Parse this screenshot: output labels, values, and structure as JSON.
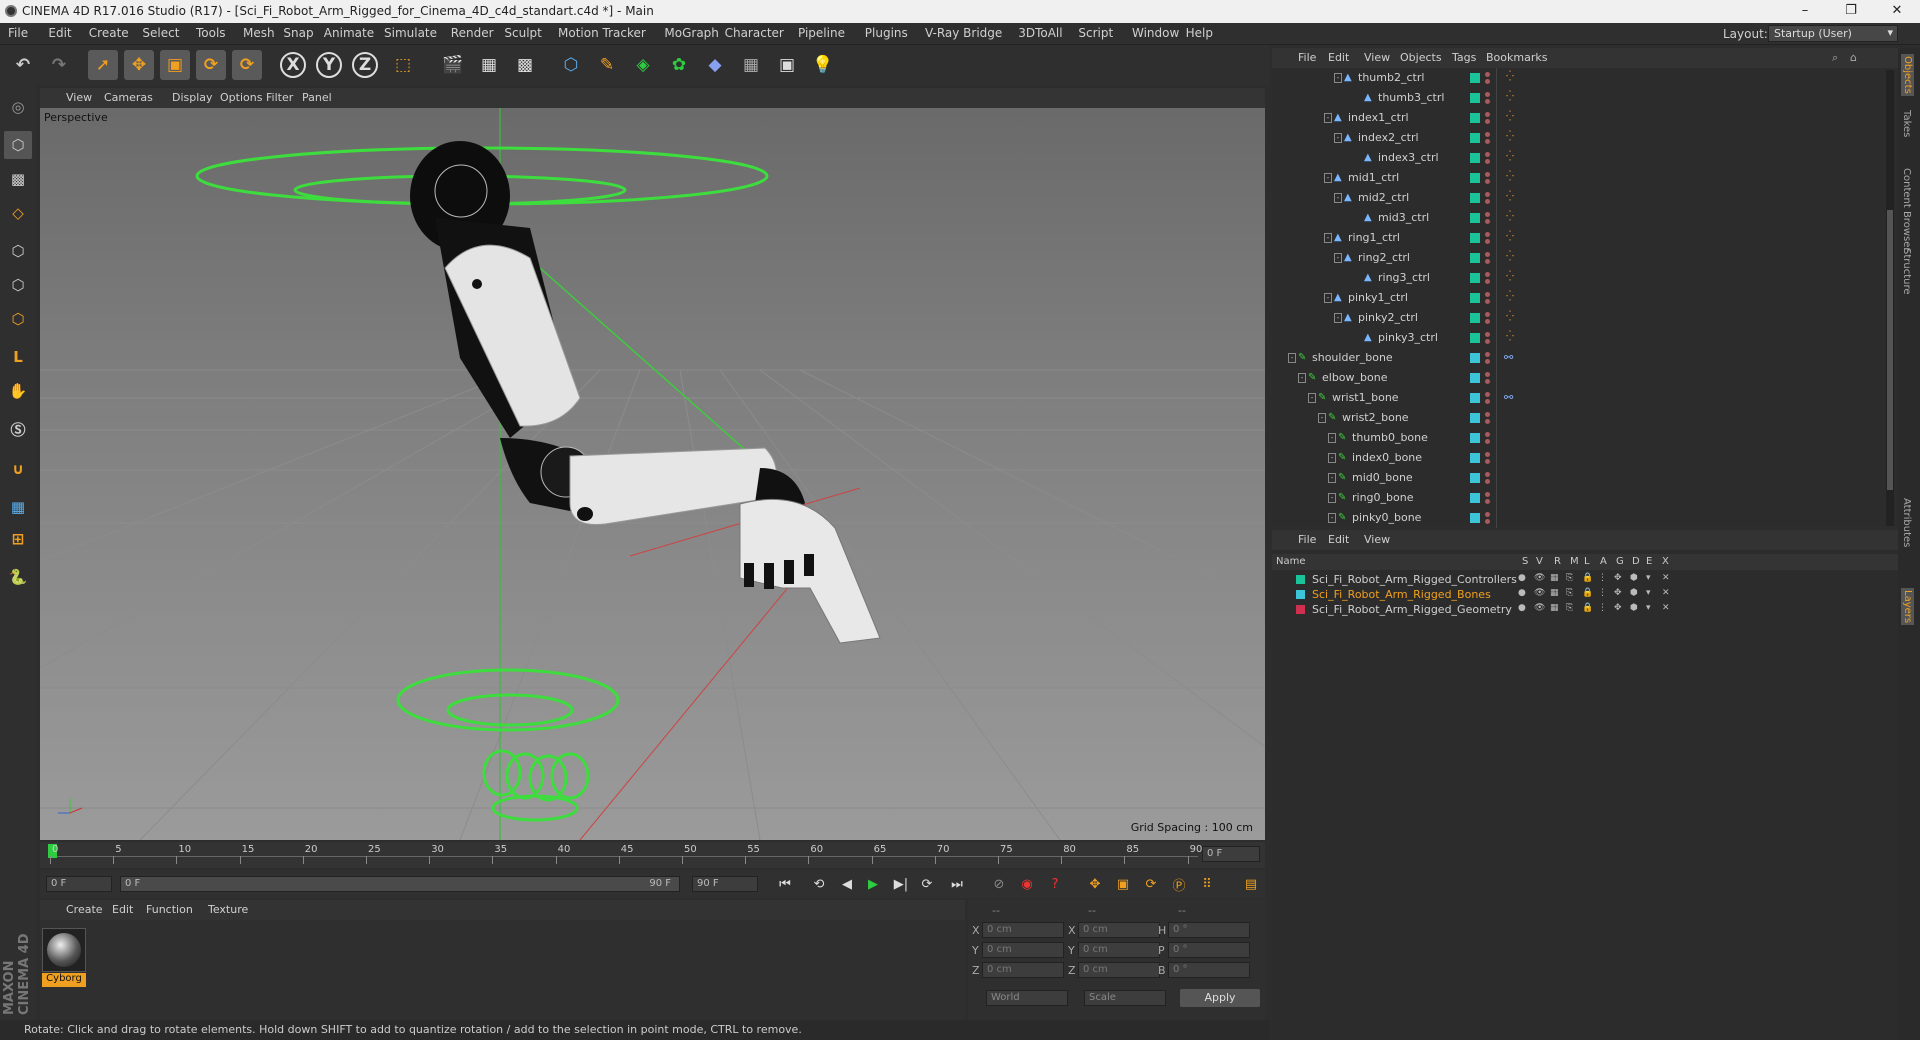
{
  "window": {
    "title": "CINEMA 4D R17.016 Studio (R17) - [Sci_Fi_Robot_Arm_Rigged_for_Cinema_4D_c4d_standart.c4d *] - Main",
    "minimize": "–",
    "maximize": "❐",
    "close": "✕"
  },
  "menu": [
    "File",
    "Edit",
    "Create",
    "Select",
    "Tools",
    "Mesh",
    "Snap",
    "Animate",
    "Simulate",
    "Render",
    "Sculpt",
    "Motion Tracker",
    "MoGraph",
    "Character",
    "Pipeline",
    "Plugins",
    "V-Ray Bridge",
    "3DToAll",
    "Script",
    "Window",
    "Help"
  ],
  "layout": {
    "label": "Layout:",
    "value": "Startup (User)"
  },
  "toolbar": {
    "icons": [
      "undo-icon",
      "redo-icon",
      "select-icon",
      "move-icon",
      "scale-icon",
      "rotate-icon",
      "recent-tool-icon",
      "x-axis-icon",
      "y-axis-icon",
      "z-axis-icon",
      "coordinate-system-icon",
      "render-view-icon",
      "render-picture-viewer-icon",
      "edit-render-settings-icon",
      "cube-icon",
      "pen-icon",
      "subdivision-icon",
      "cloner-icon",
      "deformer-icon",
      "floor-icon",
      "camera-icon",
      "light-icon"
    ],
    "x": "X",
    "y": "Y",
    "z": "Z"
  },
  "leftbar": {
    "icons": [
      "make-editable-icon",
      "model-mode-icon",
      "texture-mode-icon",
      "workplane-icon",
      "points-mode-icon",
      "edges-mode-icon",
      "polygons-mode-icon",
      "axis-mode-icon",
      "tweak-mode-icon",
      "snap-icon",
      "magnet-icon",
      "grid-icon",
      "grid-snap-icon",
      "python-icon"
    ],
    "brand": "MAXON CINEMA 4D"
  },
  "viewport": {
    "menu": [
      "View",
      "Cameras",
      "Display",
      "Options",
      "Filter",
      "Panel"
    ],
    "label": "Perspective",
    "grid_spacing": "Grid Spacing : 100 cm"
  },
  "timeline": {
    "ticks": [
      "0",
      "5",
      "10",
      "15",
      "20",
      "25",
      "30",
      "35",
      "40",
      "45",
      "50",
      "55",
      "60",
      "65",
      "70",
      "75",
      "80",
      "85",
      "90"
    ],
    "current": "0 F",
    "start": "0 F",
    "range_start": "0 F",
    "range_end": "90 F",
    "end": "90 F"
  },
  "materials": {
    "menu": [
      "Create",
      "Edit",
      "Function",
      "Texture"
    ],
    "items": [
      {
        "name": "Cyborg"
      }
    ]
  },
  "coords": {
    "headers": [
      "--",
      "--",
      "--"
    ],
    "rows": [
      {
        "a": "X",
        "av": "0 cm",
        "b": "X",
        "bv": "0 cm",
        "c": "H",
        "cv": "0 °"
      },
      {
        "a": "Y",
        "av": "0 cm",
        "b": "Y",
        "bv": "0 cm",
        "c": "P",
        "cv": "0 °"
      },
      {
        "a": "Z",
        "av": "0 cm",
        "b": "Z",
        "bv": "0 cm",
        "c": "B",
        "cv": "0 °"
      }
    ],
    "mode": "World",
    "size": "Scale",
    "apply": "Apply"
  },
  "status": "Rotate: Click and drag to rotate elements. Hold down SHIFT to add to quantize rotation / add to the selection in point mode, CTRL to remove.",
  "objects": {
    "menu": [
      "File",
      "Edit",
      "View",
      "Objects",
      "Tags",
      "Bookmarks"
    ],
    "rows": [
      {
        "name": "thumb2_ctrl",
        "indent": 72,
        "type": "ctrl",
        "color": "#1bc39a"
      },
      {
        "name": "thumb3_ctrl",
        "indent": 92,
        "type": "ctrl",
        "color": "#1bc39a"
      },
      {
        "name": "index1_ctrl",
        "indent": 62,
        "type": "ctrl",
        "color": "#1bc39a"
      },
      {
        "name": "index2_ctrl",
        "indent": 72,
        "type": "ctrl",
        "color": "#1bc39a"
      },
      {
        "name": "index3_ctrl",
        "indent": 92,
        "type": "ctrl",
        "color": "#1bc39a"
      },
      {
        "name": "mid1_ctrl",
        "indent": 62,
        "type": "ctrl",
        "color": "#1bc39a"
      },
      {
        "name": "mid2_ctrl",
        "indent": 72,
        "type": "ctrl",
        "color": "#1bc39a"
      },
      {
        "name": "mid3_ctrl",
        "indent": 92,
        "type": "ctrl",
        "color": "#1bc39a"
      },
      {
        "name": "ring1_ctrl",
        "indent": 62,
        "type": "ctrl",
        "color": "#1bc39a"
      },
      {
        "name": "ring2_ctrl",
        "indent": 72,
        "type": "ctrl",
        "color": "#1bc39a"
      },
      {
        "name": "ring3_ctrl",
        "indent": 92,
        "type": "ctrl",
        "color": "#1bc39a"
      },
      {
        "name": "pinky1_ctrl",
        "indent": 62,
        "type": "ctrl",
        "color": "#1bc39a"
      },
      {
        "name": "pinky2_ctrl",
        "indent": 72,
        "type": "ctrl",
        "color": "#1bc39a"
      },
      {
        "name": "pinky3_ctrl",
        "indent": 92,
        "type": "ctrl",
        "color": "#1bc39a"
      },
      {
        "name": "shoulder_bone",
        "indent": 26,
        "type": "bone",
        "color": "#3cc5d8"
      },
      {
        "name": "elbow_bone",
        "indent": 36,
        "type": "bone",
        "color": "#3cc5d8"
      },
      {
        "name": "wrist1_bone",
        "indent": 46,
        "type": "bone",
        "color": "#3cc5d8"
      },
      {
        "name": "wrist2_bone",
        "indent": 56,
        "type": "bone",
        "color": "#3cc5d8"
      },
      {
        "name": "thumb0_bone",
        "indent": 66,
        "type": "bone",
        "color": "#3cc5d8"
      },
      {
        "name": "index0_bone",
        "indent": 66,
        "type": "bone",
        "color": "#3cc5d8"
      },
      {
        "name": "mid0_bone",
        "indent": 66,
        "type": "bone",
        "color": "#3cc5d8"
      },
      {
        "name": "ring0_bone",
        "indent": 66,
        "type": "bone",
        "color": "#3cc5d8"
      },
      {
        "name": "pinky0_bone",
        "indent": 66,
        "type": "bone",
        "color": "#3cc5d8"
      }
    ]
  },
  "layers": {
    "menu": [
      "File",
      "Edit",
      "View"
    ],
    "columns": [
      "Name",
      "S",
      "V",
      "R",
      "M",
      "L",
      "A",
      "G",
      "D",
      "E",
      "X"
    ],
    "rows": [
      {
        "name": "Sci_Fi_Robot_Arm_Rigged_Controllers",
        "color": "#1bc39a",
        "text": "#cfcfcf"
      },
      {
        "name": "Sci_Fi_Robot_Arm_Rigged_Bones",
        "color": "#3cc5d8",
        "text": "#f0a020"
      },
      {
        "name": "Sci_Fi_Robot_Arm_Rigged_Geometry",
        "color": "#d03050",
        "text": "#cfcfcf"
      }
    ]
  },
  "right_tabs": [
    "Objects",
    "Takes",
    "Content Browser",
    "Structure",
    "Attributes",
    "Layers"
  ]
}
